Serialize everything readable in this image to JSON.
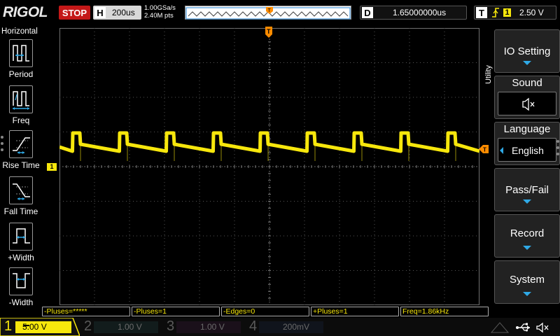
{
  "header": {
    "logo": "RIGOL",
    "run_state": "STOP",
    "horizontal_key": "H",
    "timebase": "200us",
    "sample_rate": "1.00GSa/s",
    "memory_depth": "2.40M pts",
    "trigger_pos_marker": "T",
    "delay_key": "D",
    "delay_value": "1.65000000us",
    "trigger_key": "T",
    "trigger_source": "1",
    "trigger_level": "2.50 V"
  },
  "left_menu": {
    "title": "Horizontal",
    "items": [
      {
        "label": "Period",
        "icon": "period-icon"
      },
      {
        "label": "Freq",
        "icon": "frequency-icon"
      },
      {
        "label": "Rise Time",
        "icon": "rise-time-icon"
      },
      {
        "label": "Fall Time",
        "icon": "fall-time-icon"
      },
      {
        "label": "+Width",
        "icon": "positive-width-icon"
      },
      {
        "label": "-Width",
        "icon": "negative-width-icon"
      }
    ]
  },
  "right_menu": {
    "tab": "Utility",
    "buttons": [
      {
        "label": "IO Setting",
        "icon": "chevron-down-icon"
      },
      {
        "label": "Sound",
        "icon": "speaker-muted-icon"
      },
      {
        "label": "Language",
        "value": "English"
      },
      {
        "label": "Pass/Fail",
        "icon": "chevron-down-icon"
      },
      {
        "label": "Record",
        "icon": "chevron-down-icon"
      },
      {
        "label": "System",
        "icon": "chevron-down-icon"
      }
    ]
  },
  "measurements": [
    "-Pluses=*****",
    "-Pluses=1",
    "-Edges=0",
    "+Pluses=1",
    "Freq=1.86kHz"
  ],
  "channels": [
    {
      "num": "1",
      "scale": "5.00 V",
      "color": "#f7e70c",
      "active": true
    },
    {
      "num": "2",
      "scale": "1.00 V",
      "color": "#2ec5c5",
      "active": false
    },
    {
      "num": "3",
      "scale": "1.00 V",
      "color": "#d21fd2",
      "active": false
    },
    {
      "num": "4",
      "scale": "200mV",
      "color": "#2f6fd8",
      "active": false
    }
  ],
  "ch1_marker": "1",
  "colors": {
    "trace": "#f7e70c",
    "trigger_marker": "#ff8c00",
    "accent": "#2fa9e6",
    "stop": "#c41818"
  }
}
